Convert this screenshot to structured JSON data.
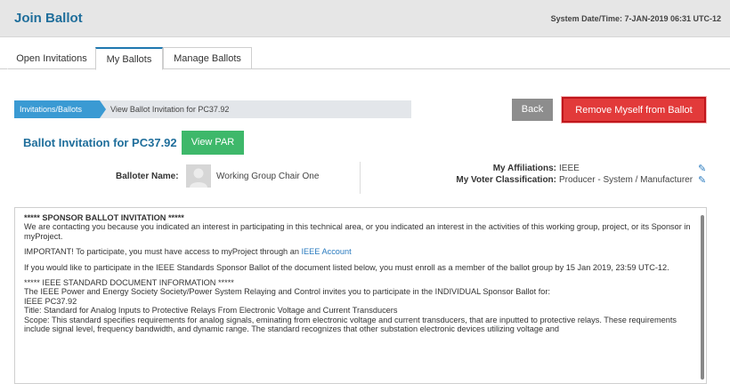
{
  "header": {
    "title": "Join Ballot",
    "system_datetime": "System Date/Time: 7-JAN-2019  06:31 UTC-12"
  },
  "tabs": [
    {
      "label": "Open Invitations"
    },
    {
      "label": "My Ballots",
      "active": true
    },
    {
      "label": "Manage Ballots"
    }
  ],
  "breadcrumb": {
    "root": "Invitations/Ballots",
    "current": "View Ballot Invitation for PC37.92"
  },
  "actions": {
    "back_label": "Back",
    "remove_label": "Remove Myself from Ballot"
  },
  "invitation": {
    "title": "Ballot Invitation for PC37.92",
    "view_par_label": "View PAR",
    "balloter_label": "Balloter Name:",
    "balloter_name": "Working Group Chair One",
    "affiliations_label": "My Affiliations:",
    "affiliations_value": "IEEE",
    "voter_class_label": "My Voter Classification:",
    "voter_class_value": "Producer - System / Manufacturer"
  },
  "message": {
    "heading": "***** SPONSOR BALLOT INVITATION *****",
    "p1": "We are contacting you because you indicated an interest in participating in this technical area, or you indicated an interest in the activities of this working group, project, or its Sponsor in myProject.",
    "p2_text": "IMPORTANT! To participate, you must have access to myProject through an ",
    "p2_link": "IEEE Account",
    "p3": "If you would like to participate in the IEEE Standards Sponsor Ballot of the document listed below, you must enroll as a member of the ballot group by 15 Jan 2019, 23:59 UTC-12.",
    "p4_heading": "***** IEEE STANDARD DOCUMENT INFORMATION *****",
    "p4_line1": "The IEEE Power and Energy Society Society/Power System Relaying and Control invites you to participate in the INDIVIDUAL Sponsor Ballot for:",
    "p4_line2": "IEEE PC37.92",
    "p4_line3": "Title: Standard for Analog Inputs to Protective Relays From Electronic Voltage and Current Transducers",
    "p4_line4": "Scope: This standard specifies requirements for analog signals, eminating from electronic voltage and current transducers, that are inputted to protective relays. These requirements include signal level, frequency bandwidth, and dynamic range. The standard recognizes that other substation electronic devices utilizing voltage and"
  },
  "colors": {
    "brand_blue": "#1f6e9b",
    "breadcrumb_blue": "#3a9ad3",
    "remove_red": "#e23a3a",
    "par_green": "#3eb86a",
    "back_gray": "#8d8d8d"
  }
}
